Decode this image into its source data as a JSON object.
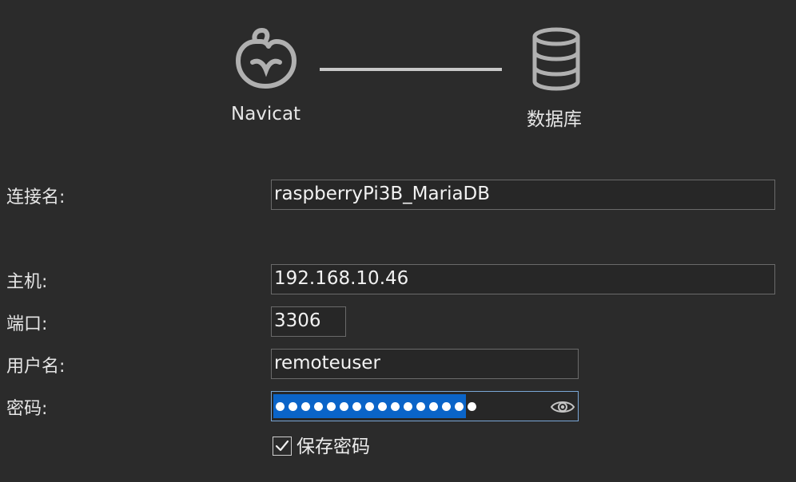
{
  "diagram": {
    "source_label": "Navicat",
    "target_label": "数据库",
    "source_icon": "navicat-logo-icon",
    "target_icon": "database-icon"
  },
  "form": {
    "connection_name": {
      "label": "连接名:",
      "value": "raspberryPi3B_MariaDB"
    },
    "host": {
      "label": "主机:",
      "value": "192.168.10.46"
    },
    "port": {
      "label": "端口:",
      "value": "3306"
    },
    "username": {
      "label": "用户名:",
      "value": "remoteuser"
    },
    "password": {
      "label": "密码:",
      "masked_length": 16,
      "selected": true,
      "reveal_icon": "eye-icon"
    },
    "save_password": {
      "label": "保存密码",
      "checked": true
    }
  },
  "colors": {
    "background": "#2b2b2b",
    "selection": "#0a64c8",
    "focus_border": "#7aa7d6"
  }
}
